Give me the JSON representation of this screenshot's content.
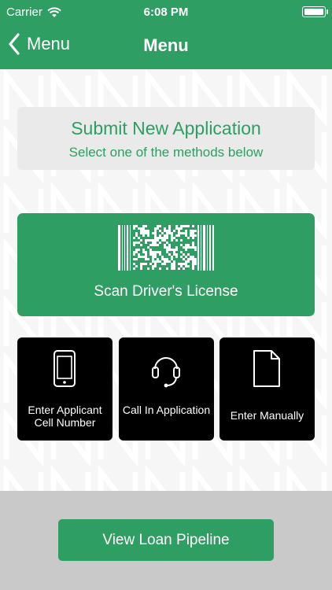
{
  "status_bar": {
    "carrier": "Carrier",
    "time": "6:08 PM"
  },
  "nav": {
    "back_label": "Menu",
    "title": "Menu"
  },
  "header_card": {
    "title": "Submit New Application",
    "subtitle": "Select one of the methods below"
  },
  "scan": {
    "label": "Scan Driver's License",
    "icon": "barcode-icon"
  },
  "options": [
    {
      "label": "Enter Applicant Cell Number",
      "icon": "phone-icon"
    },
    {
      "label": "Call In Application",
      "icon": "headset-icon"
    },
    {
      "label": "Enter Manually",
      "icon": "document-icon"
    }
  ],
  "footer": {
    "button_label": "View Loan Pipeline"
  },
  "colors": {
    "brand_green": "#2e9e62",
    "tile_black": "#000000",
    "footer_gray": "#c9c9c9"
  }
}
